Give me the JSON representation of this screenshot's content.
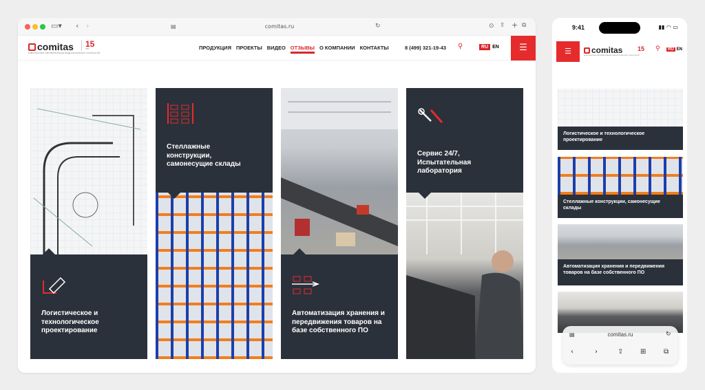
{
  "browser": {
    "url": "comitas.ru"
  },
  "site": {
    "logo": "comitas",
    "logo_tagline": "комплексные автоматизация индустриальных технологий",
    "anniversary": "15",
    "anniversary_label": "лет",
    "nav": [
      "ПРОДУКЦИЯ",
      "ПРОЕКТЫ",
      "ВИДЕО",
      "ОТЗЫВЫ",
      "О КОМПАНИИ",
      "КОНТАКТЫ"
    ],
    "phone": "8 (499) 321-19-43",
    "lang_ru": "RU",
    "lang_en": "EN"
  },
  "cards": [
    {
      "title": "Логистическое и технологическое проектирование"
    },
    {
      "title": "Стеллажные конструкции, самонесущие склады"
    },
    {
      "title": "Автоматизация хранения и передвижения товаров на базе собственного ПО"
    },
    {
      "title": "Сервис 24/7, Испытательная лаборатория"
    }
  ],
  "mobile": {
    "time": "9:41",
    "url": "comitas.ru",
    "cards": [
      {
        "title": "Логистическое и технологическое проектирование"
      },
      {
        "title": "Стеллажные конструкции, самонесущие склады"
      },
      {
        "title": "Автоматизация хранения и передвижения товаров на базе собственного ПО"
      }
    ]
  },
  "colors": {
    "accent": "#e62b2d",
    "dark": "#2b313a"
  }
}
